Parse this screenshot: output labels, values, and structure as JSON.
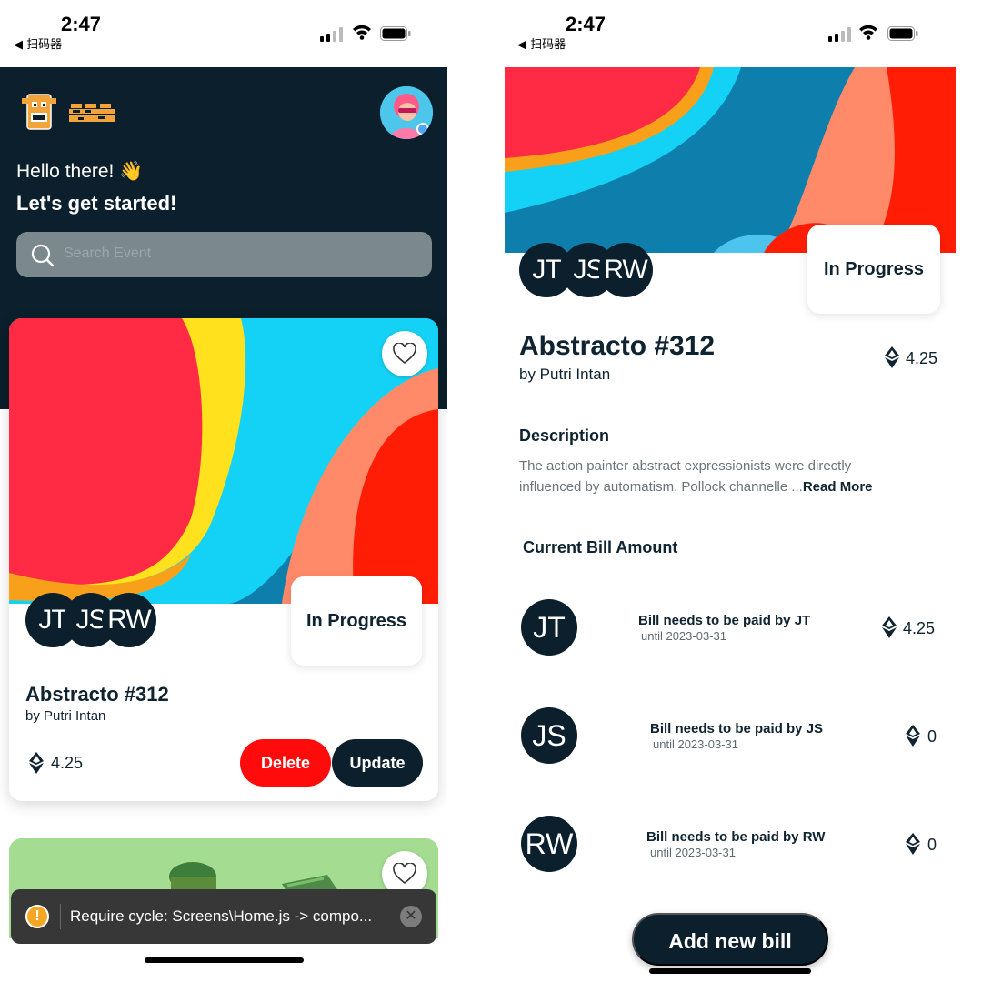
{
  "status_bar": {
    "time": "2:47",
    "back_label": "◀ 扫码器"
  },
  "home": {
    "greeting": "Hello there! 👋",
    "subtitle": "Let's get started!",
    "search": {
      "placeholder": "Search Event"
    },
    "card": {
      "title": "Abstracto #312",
      "author": "by Putri Intan",
      "status": "In Progress",
      "amount": "4.25",
      "avatars": [
        "JT",
        "JS",
        "RW"
      ],
      "delete_label": "Delete",
      "update_label": "Update"
    },
    "toast": {
      "message": "Require cycle: Screens\\Home.js -> compo..."
    }
  },
  "detail": {
    "title": "Abstracto #312",
    "author": "by Putri Intan",
    "status": "In Progress",
    "amount": "4.25",
    "avatars": [
      "JT",
      "JS",
      "RW"
    ],
    "description_heading": "Description",
    "description_text": "The action painter abstract expressionists were directly influenced by automatism. Pollock channelle ...",
    "read_more": "Read More",
    "bill_heading": "Current Bill Amount",
    "bills": [
      {
        "initials": "JT",
        "text": "Bill needs to be paid by JT",
        "due": "until 2023-03-31",
        "amount": "4.25"
      },
      {
        "initials": "JS",
        "text": "Bill needs to be paid by JS",
        "due": "until 2023-03-31",
        "amount": "0"
      },
      {
        "initials": "RW",
        "text": "Bill needs to be paid by RW",
        "due": "until 2023-03-31",
        "amount": "0"
      }
    ],
    "add_button": "Add new bill"
  },
  "colors": {
    "navy": "#0b1f2c",
    "delete_red": "#ff0b0b",
    "art_red": "#ff2b44",
    "art_yellow": "#ffe11d",
    "art_cyan": "#14d2f5",
    "art_blue": "#0e7fad",
    "art_salmon": "#ff8a6a",
    "art_orange_red": "#ff1e05"
  }
}
